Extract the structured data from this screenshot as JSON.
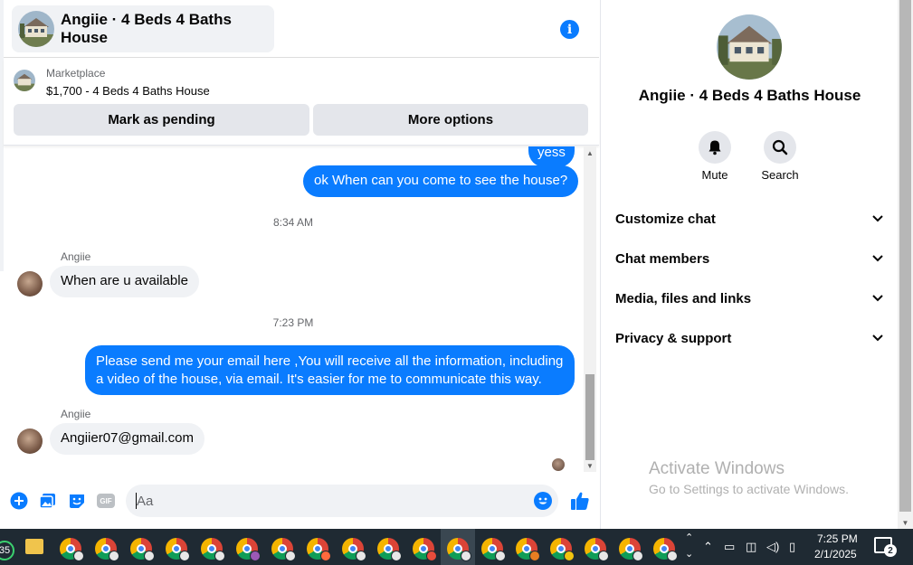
{
  "conversation": {
    "title": "Angiie · 4 Beds 4 Baths House"
  },
  "marketplace": {
    "label": "Marketplace",
    "listing": "$1,700 - 4 Beds 4 Baths House",
    "pending_label": "Mark as pending",
    "more_label": "More options"
  },
  "messages": {
    "out1": "yess",
    "out2": "ok When can you come to see the house?",
    "time1": "8:34 AM",
    "sender1": "Angiie",
    "in1": "When are u available",
    "time2": "7:23 PM",
    "out3_line1": "Please send me your email here ,You will receive all the information, including",
    "out3_line2": "a video of the house, via email. It's easier for me to communicate this way.",
    "sender2": "Angiie",
    "in2": "Angiier07@gmail.com"
  },
  "composer": {
    "placeholder": "Aa",
    "gif_label": "GIF"
  },
  "info_panel": {
    "title": "Angiie · 4 Beds 4 Baths House",
    "mute_label": "Mute",
    "search_label": "Search",
    "sections": [
      "Customize chat",
      "Chat members",
      "Media, files and links",
      "Privacy & support"
    ]
  },
  "watermark": {
    "line1": "Activate Windows",
    "line2": "Go to Settings to activate Windows."
  },
  "taskbar": {
    "badge_count": "35",
    "time": "7:25 PM",
    "date": "2/1/2025",
    "notification_count": "2"
  },
  "colors": {
    "accent": "#0a7cff",
    "bubble_in": "#f0f2f5",
    "taskbar": "#1f2a33"
  }
}
